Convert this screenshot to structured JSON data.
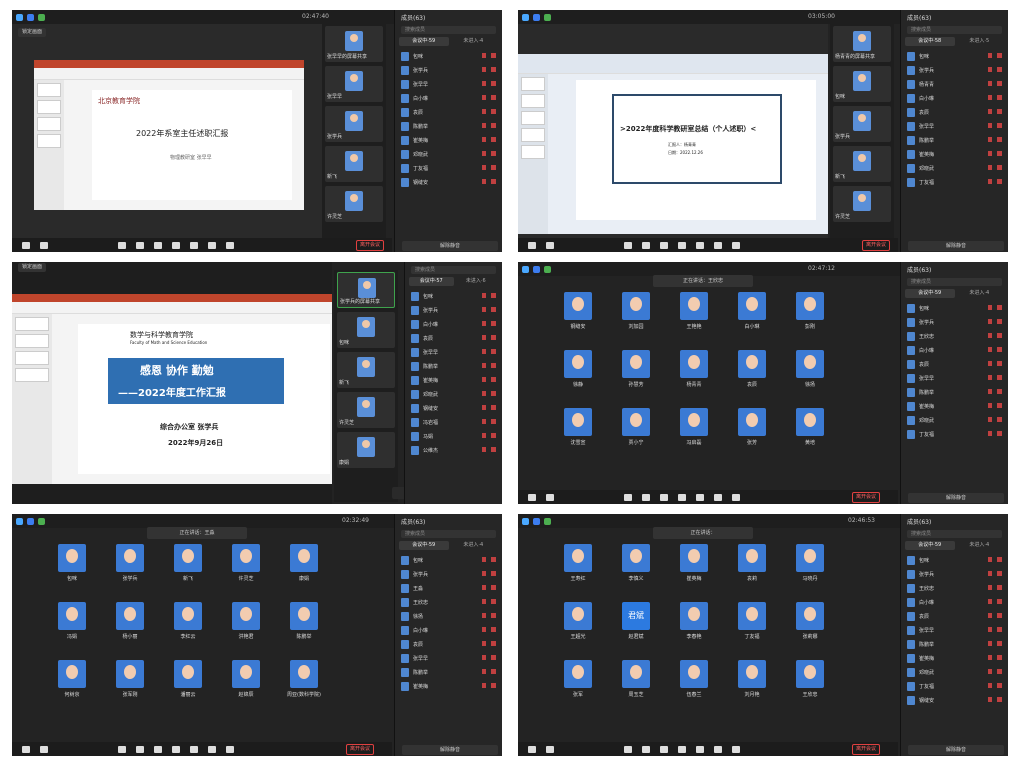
{
  "panels": [
    {
      "timer": "02:47:40",
      "view_label": "演讲者视图",
      "members_label": "成员(63)",
      "lock_label": "锁定画面",
      "search_placeholder": "搜索成员",
      "tab_in": "会议中·59",
      "tab_out": "未进入·4",
      "leave_label": "离开会议",
      "mute_all_label": "解除静音",
      "slide": {
        "title": "2022年系室主任述职汇报",
        "subtitle": "物理教研室 张早早",
        "logo_text": "北京教育学院"
      },
      "strip": [
        "张早早的屏幕共享",
        "张早早",
        "张学兵",
        "新飞",
        "许灵芝",
        ""
      ],
      "roster": [
        "包咪",
        "张学兵",
        "张早早",
        "白小琳",
        "袁辰",
        "陈鹏举",
        "崔英梅",
        "邓晓武",
        "丁友福",
        "钢缝安"
      ]
    },
    {
      "timer": "03:05:00",
      "view_label": "演讲者视图",
      "members_label": "成员(63)",
      "search_placeholder": "搜索成员",
      "tab_in": "会议中·58",
      "tab_out": "未进入·5",
      "leave_label": "离开会议",
      "mute_all_label": "解除静音",
      "slide": {
        "title": ">2022年度科学教研室总结（个人述职）<",
        "subtitle": "汇报人：杨青青",
        "date": "日期：2022.12.26"
      },
      "strip": [
        "杨青青的屏幕共享",
        "包咪",
        "",
        "张学兵",
        "新飞",
        "许灵芝"
      ],
      "roster": [
        "包咪",
        "张学兵",
        "杨青青",
        "白小琳",
        "袁辰",
        "张早早",
        "陈鹏举",
        "崔英梅",
        "邓晓武",
        "丁友福"
      ]
    },
    {
      "lock_label": "锁定画面",
      "search_placeholder": "搜索成员",
      "tab_in": "会议中·57",
      "tab_out": "未进入·6",
      "speaking": "正在讲话：张学兵",
      "slide": {
        "school": "数学与科学教育学院",
        "school_en": "Faculty of Math and Science Education",
        "line1": "感恩 协作 勤勉",
        "line2": "——2022年度工作汇报",
        "dept": "综合办公室 张学兵",
        "date": "2022年9月26日"
      },
      "strip": [
        "张学兵的屏幕共享",
        "包咪",
        "新飞",
        "许灵芝",
        "康娟"
      ],
      "roster": [
        "包咪",
        "张学兵",
        "白小琳",
        "袁辰",
        "张早早",
        "陈鹏举",
        "崔英梅",
        "邓晓武",
        "钢缝安",
        "冯岩福",
        "马娟",
        "公维杰"
      ]
    },
    {
      "timer": "02:47:12",
      "members_label": "成员(63)",
      "search_placeholder": "搜索成员",
      "tab_in": "会议中·59",
      "tab_out": "未进入·4",
      "speaking": "正在讲话：王欣忠",
      "leave_label": "离开会议",
      "mute_all_label": "解除静音",
      "grid": [
        "钢缝安",
        "刘加园",
        "王艳艳",
        "白小琳",
        "彭刚",
        "徐静",
        "孙慧芳",
        "杨青青",
        "袁辰",
        "徐扬",
        "沈雪宣",
        "贾小宁",
        "冯启磊",
        "张芳",
        "黄培"
      ],
      "roster": [
        "包咪",
        "张学兵",
        "王欣忠",
        "白小琳",
        "袁辰",
        "张早早",
        "陈鹏举",
        "崔英梅",
        "邓晓武",
        "丁友福"
      ]
    },
    {
      "timer": "02:32:49",
      "members_label": "成员(63)",
      "search_placeholder": "搜索成员",
      "tab_in": "会议中·59",
      "tab_out": "未进入·4",
      "speaking": "正在讲话：王淼",
      "leave_label": "离开会议",
      "mute_all_label": "解除静音",
      "grid": [
        "包咪",
        "张学兵",
        "新飞",
        "许灵芝",
        "康娟",
        "冯娟",
        "杨小丽",
        "李红云",
        "洪艳君",
        "陈鹏举",
        "何树京",
        "张军刚",
        "潘丽云",
        "赵锦辰",
        "周亚(数科学院)"
      ],
      "roster": [
        "包咪",
        "张学兵",
        "王淼",
        "王欣忠",
        "徐扬",
        "白小琳",
        "袁辰",
        "张早早",
        "陈鹏举",
        "崔英梅"
      ]
    },
    {
      "timer": "02:46:53",
      "members_label": "成员(63)",
      "search_placeholder": "搜索成员",
      "tab_in": "会议中·59",
      "tab_out": "未进入·4",
      "speaking": "正在讲话：",
      "leave_label": "离开会议",
      "mute_all_label": "解除静音",
      "grid": [
        "王寿红",
        "李慎义",
        "崔英梅",
        "袁莉",
        "马晓丹",
        "王超光",
        "赵君斌",
        "李春艳",
        "丁友福",
        "张莉娜",
        "张军",
        "周玉芝",
        "伍春兰",
        "刘月艳",
        "王欣忠"
      ],
      "grid_text_avatar": "君斌",
      "roster": [
        "包咪",
        "张学兵",
        "王欣忠",
        "白小琳",
        "袁辰",
        "张早早",
        "陈鹏举",
        "崔英梅",
        "邓晓武",
        "丁友福",
        "钢缝安"
      ]
    }
  ]
}
